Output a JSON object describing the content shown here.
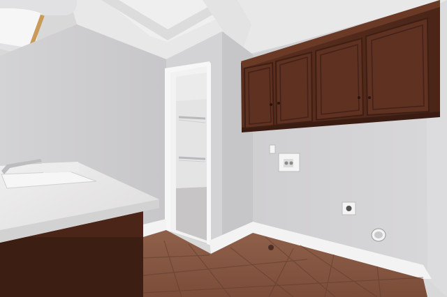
{
  "scene": {
    "kind": "photo",
    "subject": "laundry-room",
    "palette": {
      "wall": "#d6d5d6",
      "wall_shadow": "#c9c8ca",
      "ceiling": "#e9e9ea",
      "trim": "#f4f4f4",
      "cabinet": "#5a2e1f",
      "cabinet_dark": "#3f1f14",
      "floor_tile": "#8a5a43",
      "grout": "#6b4636",
      "countertop": "#e7e6e6",
      "closet_carpet": "#c9c6c7"
    }
  }
}
